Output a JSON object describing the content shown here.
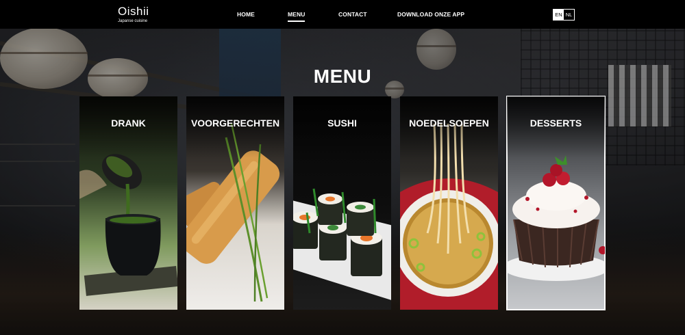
{
  "brand": {
    "name": "Oishii",
    "tagline": "Japanse cuisine"
  },
  "nav": {
    "items": [
      {
        "label": "HOME",
        "active": false
      },
      {
        "label": "MENU",
        "active": true
      },
      {
        "label": "CONTACT",
        "active": false
      },
      {
        "label": "DOWNLOAD ONZE APP",
        "active": false
      }
    ]
  },
  "language": {
    "options": [
      "EN",
      "NL"
    ],
    "selected": "EN"
  },
  "page": {
    "title": "MENU"
  },
  "categories": [
    {
      "label": "DRANK",
      "image_icon": "matcha-tea-icon"
    },
    {
      "label": "VOORGERECHTEN",
      "image_icon": "spring-roll-icon"
    },
    {
      "label": "SUSHI",
      "image_icon": "sushi-roll-icon"
    },
    {
      "label": "NOEDELSOEPEN",
      "image_icon": "noodle-soup-icon"
    },
    {
      "label": "DESSERTS",
      "image_icon": "cupcake-icon",
      "selected": true
    }
  ],
  "colors": {
    "header_bg": "#000000",
    "text": "#ffffff",
    "accent_border": "#ffffff"
  }
}
